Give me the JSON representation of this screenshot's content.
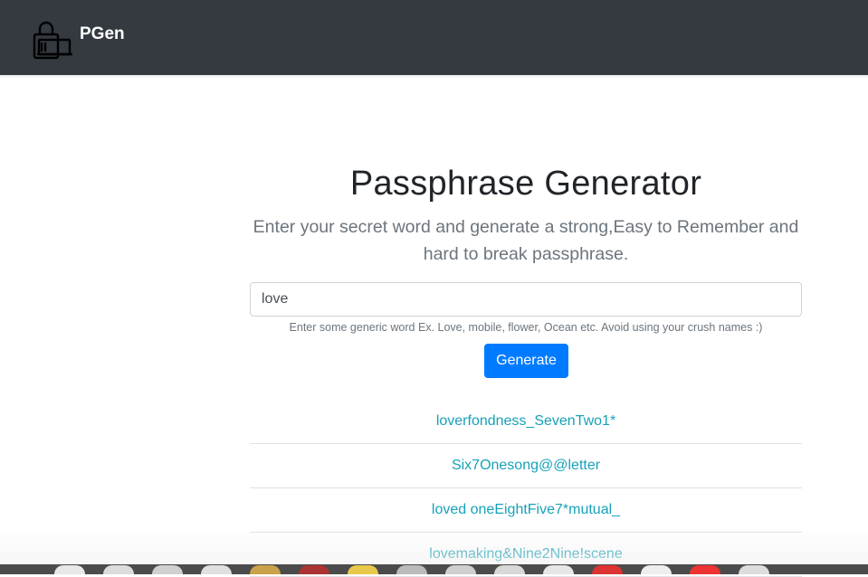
{
  "navbar": {
    "brand_name": "PGen",
    "logo_icon": "lock-laptop-icon"
  },
  "main": {
    "title": "Passphrase Generator",
    "lead": "Enter your secret word and generate a strong,Easy to Remember and hard to break passphrase.",
    "input": {
      "value": "love",
      "placeholder": ""
    },
    "help_text": "Enter some generic word Ex. Love, mobile, flower, Ocean etc. Avoid using your crush names :)",
    "generate_label": "Generate"
  },
  "results": [
    "loverfondness_SevenTwo1*",
    "Six7Onesong@@letter",
    "loved oneEightFive7*mutual_",
    "lovemaking&Nine2Nine!scene"
  ],
  "colors": {
    "navbar": "#343a40",
    "primary": "#007bff",
    "result_text": "#17a2b8",
    "muted": "#6c757d"
  },
  "dock": {
    "icons": [
      "finder-icon",
      "launchpad-icon",
      "safari-icon",
      "app-icon",
      "app-icon",
      "app-icon",
      "app-icon",
      "app-icon",
      "app-icon",
      "app-icon",
      "app-icon",
      "app-icon",
      "app-icon",
      "app-icon",
      "app-icon"
    ]
  }
}
